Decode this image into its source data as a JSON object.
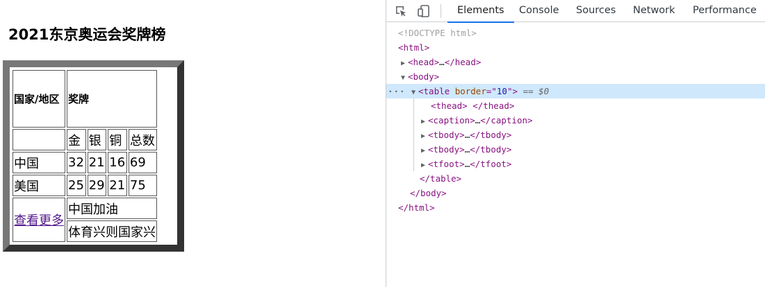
{
  "page": {
    "title": "2021东京奥运会奖牌榜",
    "table": {
      "header": {
        "region": "国家/地区",
        "medal": "奖牌"
      },
      "medal_types": [
        "金",
        "银",
        "铜",
        "总数"
      ],
      "rows": [
        {
          "country": "中国",
          "gold": "32",
          "silver": "21",
          "bronze": "16",
          "total": "69"
        },
        {
          "country": "美国",
          "gold": "25",
          "silver": "29",
          "bronze": "21",
          "total": "75"
        }
      ],
      "footer": {
        "link": "查看更多",
        "slogan1": "中国加油",
        "slogan2": "体育兴则国家兴"
      }
    }
  },
  "devtools": {
    "tabs": [
      "Elements",
      "Console",
      "Sources",
      "Network",
      "Performance"
    ],
    "active_tab": "Elements",
    "accent_color": "#1a73e8",
    "icons": [
      "inspect-element-icon",
      "device-toolbar-icon"
    ],
    "tree": {
      "doctype": "<!DOCTYPE html>",
      "html_open": "<html>",
      "head": {
        "open": "<head>",
        "ellipsis": "…",
        "close": "</head>"
      },
      "body_open": "<body>",
      "more_dots": "···",
      "table": {
        "tag_open": "<table",
        "attr_name": "border",
        "attr_eq": "=\"",
        "attr_value": "10",
        "attr_close": "\">",
        "eq_marker": "==",
        "dollar": "$0"
      },
      "thead": "<thead> </thead>",
      "caption": {
        "open": "<caption>",
        "ellipsis": "…",
        "close": "</caption>"
      },
      "tbody1": {
        "open": "<tbody>",
        "ellipsis": "…",
        "close": "</tbody>"
      },
      "tbody2": {
        "open": "<tbody>",
        "ellipsis": "…",
        "close": "</tbody>"
      },
      "tfoot": {
        "open": "<tfoot>",
        "ellipsis": "…",
        "close": "</tfoot>"
      },
      "table_close": "</table>",
      "body_close": "</body>",
      "html_close": "</html>"
    }
  }
}
